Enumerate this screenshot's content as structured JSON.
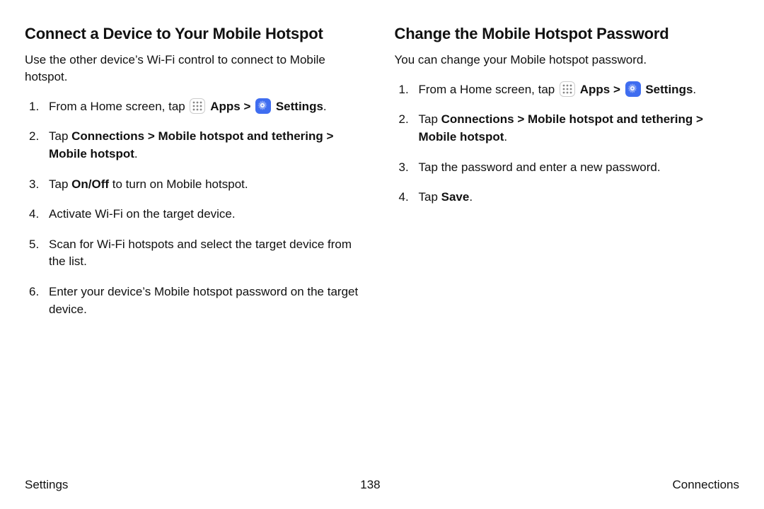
{
  "left": {
    "heading": "Connect a Device to Your Mobile Hotspot",
    "intro": "Use the other device’s Wi-Fi control to connect to Mobile hotspot.",
    "step1_a": "From a Home screen, tap ",
    "apps_label": "Apps",
    "settings_label": "Settings",
    "step2_a": "Tap ",
    "step2_b": "Connections",
    "step2_c": "Mobile hotspot and tethering",
    "step2_d": "Mobile hotspot",
    "step3_a": "Tap ",
    "step3_b": "On/Off",
    "step3_c": " to turn on Mobile hotspot.",
    "step4": "Activate Wi-Fi on the target device.",
    "step5": "Scan for Wi-Fi hotspots and select the target device from the list.",
    "step6": "Enter your device’s Mobile hotspot password on the target device."
  },
  "right": {
    "heading": "Change the Mobile Hotspot Password",
    "intro": "You can change your Mobile hotspot password.",
    "step1_a": "From a Home screen, tap ",
    "apps_label": "Apps",
    "settings_label": "Settings",
    "step2_a": "Tap ",
    "step2_b": "Connections",
    "step2_c": "Mobile hotspot and tethering",
    "step2_d": "Mobile hotspot",
    "step3": "Tap the password and enter a new password.",
    "step4_a": "Tap ",
    "step4_b": "Save"
  },
  "footer": {
    "left": "Settings",
    "center": "138",
    "right": "Connections"
  },
  "glyphs": {
    "chevron": ">",
    "period": "."
  }
}
